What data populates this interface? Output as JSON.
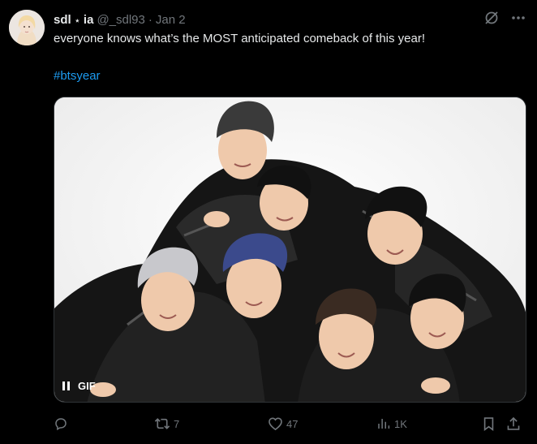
{
  "author": {
    "display_name": "sdl",
    "name_star": "⋆",
    "name_suffix": "ia",
    "handle": "@_sdl93",
    "separator": "·",
    "date": "Jan 2"
  },
  "tweet": {
    "text": "everyone knows what’s the MOST anticipated comeback of this year!",
    "hashtag": "#btsyear"
  },
  "media": {
    "badge": "GIF"
  },
  "actions": {
    "retweets": "7",
    "likes": "47",
    "views": "1K"
  },
  "colors": {
    "background": "#000000",
    "text": "#e7e9ea",
    "muted": "#71767b",
    "link": "#1d9bf0"
  },
  "icons": {
    "grok": "grok-icon",
    "more": "more-icon",
    "reply": "reply-icon",
    "retweet": "retweet-icon",
    "like": "heart-icon",
    "views": "views-icon",
    "bookmark": "bookmark-icon",
    "share": "share-icon",
    "pause": "pause-icon"
  }
}
